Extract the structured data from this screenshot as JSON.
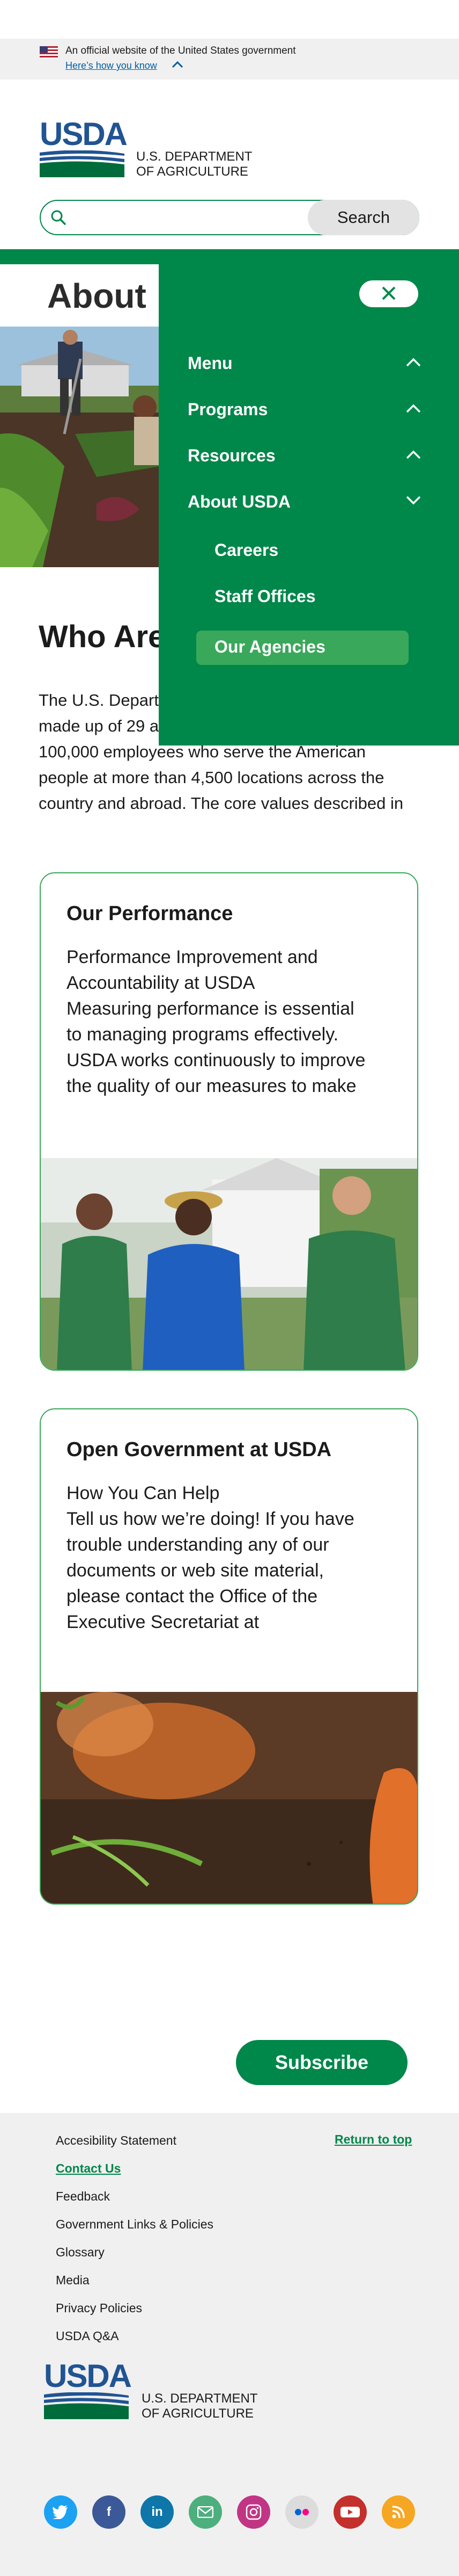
{
  "gov_banner": {
    "text": "An official website of the United States government",
    "link": "Here’s how you know"
  },
  "header": {
    "logo_text": "USDA",
    "dept_line1": "U.S. DEPARTMENT",
    "dept_line2": "OF AGRICULTURE"
  },
  "search": {
    "placeholder": "",
    "button_label": "Search"
  },
  "page": {
    "title": "About",
    "section_title": "Who Are",
    "body_lines": [
      "The U.S. Depart",
      "made up of 29 a",
      "100,000 employees who serve the American",
      "people at more than 4,500 locations across the",
      "country and abroad. The core values described in"
    ]
  },
  "menu": {
    "items": [
      {
        "label": "Menu",
        "state": "collapsed"
      },
      {
        "label": "Programs",
        "state": "collapsed"
      },
      {
        "label": "Resources",
        "state": "collapsed"
      },
      {
        "label": "About USDA",
        "state": "expanded"
      }
    ],
    "sub_items": [
      {
        "label": "Careers"
      },
      {
        "label": "Staff Offices"
      },
      {
        "label": "Our Agencies",
        "active": true
      }
    ]
  },
  "cards": [
    {
      "title": "Our Performance",
      "lines": [
        "Performance Improvement and",
        "Accountability at USDA",
        "Measuring performance is essential",
        "to managing programs effectively.",
        "USDA works continuously to improve",
        "the quality of our measures to make"
      ]
    },
    {
      "title": "Open Government at USDA",
      "lines": [
        "How You Can Help",
        "Tell us how we’re doing! If you have",
        "trouble understanding any of our",
        "documents or web site material,",
        "please contact the Office of the",
        "Executive Secretariat at"
      ]
    }
  ],
  "subscribe_label": "Subscribe",
  "footer": {
    "return_top": "Return to top",
    "links": [
      {
        "label": "Accesibility Statement"
      },
      {
        "label": "Contact Us",
        "active": true
      },
      {
        "label": "Feedback"
      },
      {
        "label": "Government Links & Policies"
      },
      {
        "label": "Glossary"
      },
      {
        "label": "Media"
      },
      {
        "label": "Privacy Policies"
      },
      {
        "label": "USDA Q&A"
      }
    ],
    "logo_text": "USDA",
    "dept_line1": "U.S. DEPARTMENT",
    "dept_line2": "OF AGRICULTURE",
    "social": [
      {
        "icon": "twitter-icon",
        "color": "#1da1f2"
      },
      {
        "icon": "facebook-icon",
        "color": "#3b5998"
      },
      {
        "icon": "linkedin-icon",
        "color": "#0e76a8"
      },
      {
        "icon": "email-icon",
        "color": "#4caf7d"
      },
      {
        "icon": "instagram-icon",
        "color": "#c13584"
      },
      {
        "icon": "flickr-icon",
        "color": "#dcdcdc"
      },
      {
        "icon": "youtube-icon",
        "color": "#c4302b"
      },
      {
        "icon": "rss-icon",
        "color": "#f5a623"
      }
    ]
  },
  "colors": {
    "brand_green": "#00874a",
    "light_green": "#3aa85a",
    "usda_blue": "#205493"
  }
}
